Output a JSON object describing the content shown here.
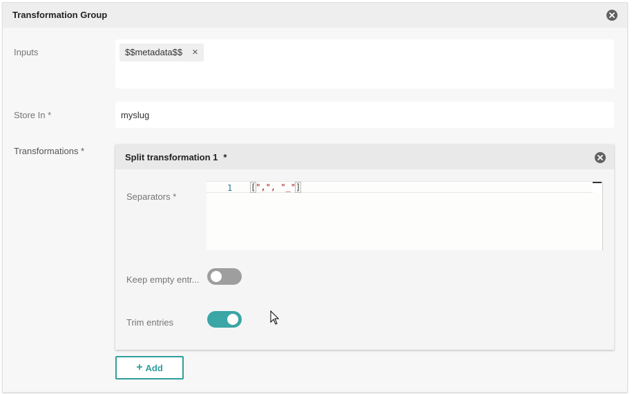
{
  "panel": {
    "title": "Transformation Group",
    "close_icon": "close-circle-icon"
  },
  "inputs": {
    "label": "Inputs",
    "chips": [
      {
        "text": "$$metadata$$",
        "remove_glyph": "×"
      }
    ]
  },
  "store_in": {
    "label": "Store In *",
    "value": "myslug"
  },
  "transformations": {
    "label": "Transformations *",
    "items": [
      {
        "title": "Split transformation 1",
        "title_marker": "*",
        "close_icon": "close-circle-icon",
        "separators": {
          "label": "Separators *",
          "line_number": "1",
          "code_open": "[",
          "code_body": "\",\", \"_\"",
          "code_close": "]"
        },
        "keep_empty_entries": {
          "label": "Keep empty entr...",
          "enabled": false
        },
        "trim_entries": {
          "label": "Trim entries",
          "enabled": true
        }
      }
    ]
  },
  "add_button": {
    "icon": "plus-icon",
    "plus": "+",
    "label": "Add"
  },
  "colors": {
    "accent": "#3aa6a5",
    "toggle_off": "#9e9e9e",
    "close_icon": "#616161"
  }
}
